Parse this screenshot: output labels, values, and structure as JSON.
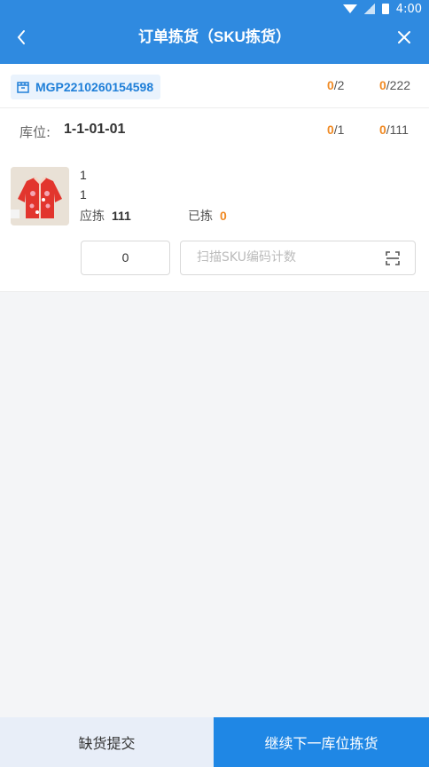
{
  "status_bar": {
    "time": "4:00",
    "icons": [
      "wifi-icon",
      "signal-icon",
      "battery-icon"
    ]
  },
  "header": {
    "title": "订单拣货（SKU拣货）",
    "back_icon": "chevron-left-icon",
    "close_icon": "close-icon"
  },
  "order": {
    "icon": "package-box-icon",
    "number": "MGP2210260154598",
    "count1_done": "0",
    "count1_total": "/2",
    "count2_done": "0",
    "count2_total": "/222"
  },
  "location": {
    "label": "库位:",
    "value": "1-1-01-01",
    "count1_done": "0",
    "count1_total": "/1",
    "count2_done": "0",
    "count2_total": "/111"
  },
  "item": {
    "line1": "1",
    "line2": "1",
    "should_pick_label": "应拣",
    "should_pick_value": "111",
    "picked_label": "已拣",
    "picked_value": "0",
    "quantity_value": "0",
    "scan_placeholder": "扫描SKU编码计数",
    "scan_icon": "scan-icon"
  },
  "footer": {
    "shortage_label": "缺货提交",
    "next_label": "继续下一库位拣货"
  },
  "colors": {
    "primary": "#2f8ae0",
    "accent": "#f08a24",
    "footer_button": "#1f87e5"
  }
}
